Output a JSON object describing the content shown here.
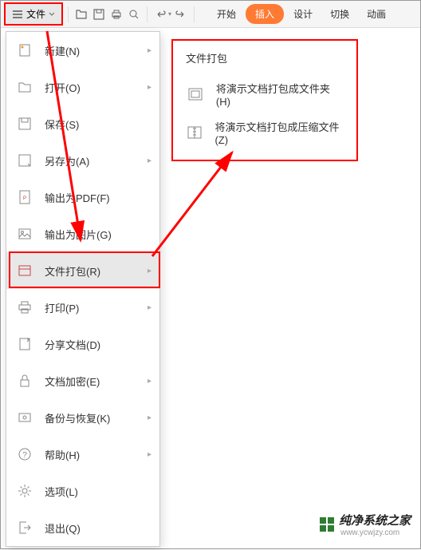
{
  "toolbar": {
    "file_label": "文件",
    "tabs": {
      "start": "开始",
      "insert": "插入",
      "design": "设计",
      "switch": "切换",
      "anim": "动画"
    }
  },
  "menu": {
    "new": "新建(N)",
    "open": "打开(O)",
    "save": "保存(S)",
    "saveas": "另存为(A)",
    "exportpdf": "输出为PDF(F)",
    "exportimg": "输出为图片(G)",
    "package": "文件打包(R)",
    "print": "打印(P)",
    "share": "分享文档(D)",
    "encrypt": "文档加密(E)",
    "backup": "备份与恢复(K)",
    "help": "帮助(H)",
    "options": "选项(L)",
    "exit": "退出(Q)"
  },
  "submenu": {
    "title": "文件打包",
    "folder": "将演示文档打包成文件夹(H)",
    "zip": "将演示文档打包成压缩文件(Z)"
  },
  "watermark": {
    "brand": "纯净系统之家",
    "url": "www.ycwjzy.com"
  }
}
